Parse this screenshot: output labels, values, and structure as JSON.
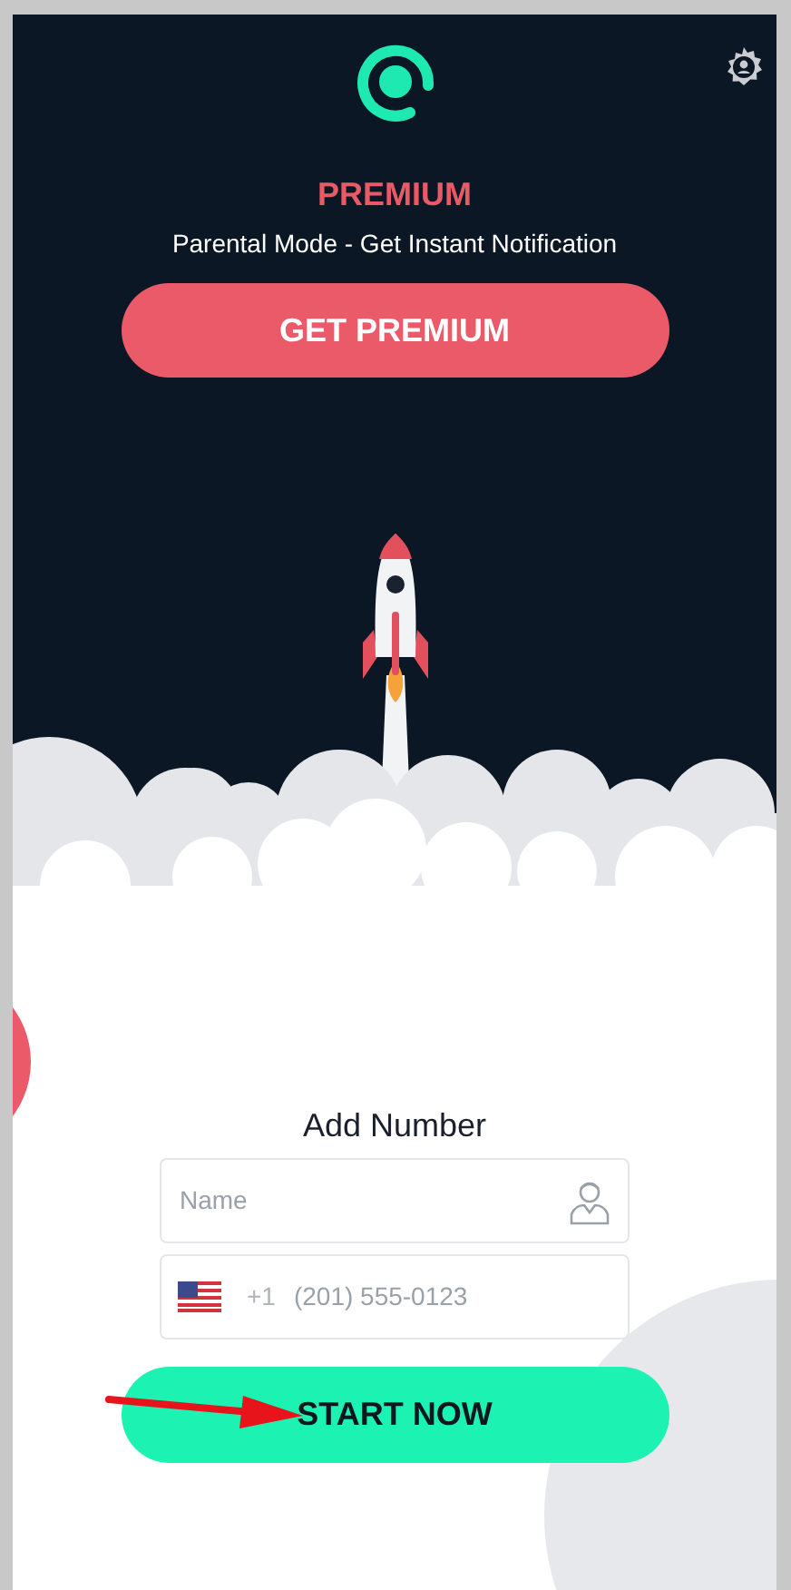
{
  "header": {
    "premium_title": "PREMIUM",
    "subtitle": "Parental Mode - Get Instant Notification",
    "get_premium_button": "GET PREMIUM"
  },
  "form": {
    "title": "Add Number",
    "name_field": {
      "placeholder": "Name"
    },
    "phone_field": {
      "dial_code": "+1",
      "placeholder": "(201) 555-0123"
    },
    "start_button": "START NOW"
  }
}
